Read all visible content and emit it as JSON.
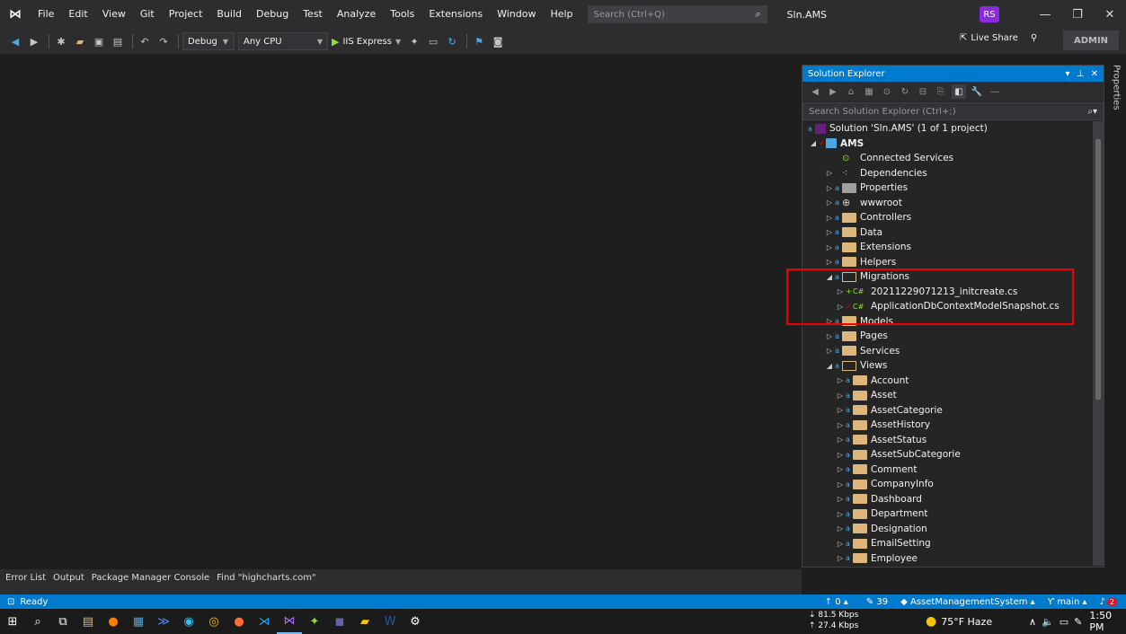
{
  "menubar": {
    "logo": "⋈",
    "items": [
      "File",
      "Edit",
      "View",
      "Git",
      "Project",
      "Build",
      "Debug",
      "Test",
      "Analyze",
      "Tools",
      "Extensions",
      "Window",
      "Help"
    ],
    "search_placeholder": "Search (Ctrl+Q)",
    "solution_name": "Sln.AMS",
    "avatar_initials": "RS"
  },
  "toolbar": {
    "config": "Debug",
    "platform": "Any CPU",
    "run_target": "IIS Express",
    "live_share": "Live Share",
    "admin": "ADMIN"
  },
  "solution_explorer": {
    "title": "Solution Explorer",
    "search_placeholder": "Search Solution Explorer (Ctrl+;)",
    "solution_label": "Solution 'Sln.AMS' (1 of 1 project)",
    "project": "AMS",
    "items": [
      {
        "label": "Connected Services",
        "indent": 3,
        "expander": "",
        "icon": "connected"
      },
      {
        "label": "Dependencies",
        "indent": 3,
        "expander": "▷",
        "icon": "deps"
      },
      {
        "label": "Properties",
        "indent": 3,
        "expander": "▷",
        "icon": "props"
      },
      {
        "label": "wwwroot",
        "indent": 3,
        "expander": "▷",
        "icon": "globe"
      },
      {
        "label": "Controllers",
        "indent": 3,
        "expander": "▷",
        "icon": "folder"
      },
      {
        "label": "Data",
        "indent": 3,
        "expander": "▷",
        "icon": "folder"
      },
      {
        "label": "Extensions",
        "indent": 3,
        "expander": "▷",
        "icon": "folder"
      },
      {
        "label": "Helpers",
        "indent": 3,
        "expander": "▷",
        "icon": "folder"
      },
      {
        "label": "Migrations",
        "indent": 3,
        "expander": "◢",
        "icon": "folder-open"
      },
      {
        "label": "20211229071213_initcreate.cs",
        "indent": 4,
        "expander": "▷",
        "icon": "cs-add"
      },
      {
        "label": "ApplicationDbContextModelSnapshot.cs",
        "indent": 4,
        "expander": "▷",
        "icon": "cs-check"
      },
      {
        "label": "Models",
        "indent": 3,
        "expander": "▷",
        "icon": "folder"
      },
      {
        "label": "Pages",
        "indent": 3,
        "expander": "▷",
        "icon": "folder"
      },
      {
        "label": "Services",
        "indent": 3,
        "expander": "▷",
        "icon": "folder"
      },
      {
        "label": "Views",
        "indent": 3,
        "expander": "◢",
        "icon": "folder-open"
      },
      {
        "label": "Account",
        "indent": 4,
        "expander": "▷",
        "icon": "folder"
      },
      {
        "label": "Asset",
        "indent": 4,
        "expander": "▷",
        "icon": "folder"
      },
      {
        "label": "AssetCategorie",
        "indent": 4,
        "expander": "▷",
        "icon": "folder"
      },
      {
        "label": "AssetHistory",
        "indent": 4,
        "expander": "▷",
        "icon": "folder"
      },
      {
        "label": "AssetStatus",
        "indent": 4,
        "expander": "▷",
        "icon": "folder"
      },
      {
        "label": "AssetSubCategorie",
        "indent": 4,
        "expander": "▷",
        "icon": "folder"
      },
      {
        "label": "Comment",
        "indent": 4,
        "expander": "▷",
        "icon": "folder"
      },
      {
        "label": "CompanyInfo",
        "indent": 4,
        "expander": "▷",
        "icon": "folder"
      },
      {
        "label": "Dashboard",
        "indent": 4,
        "expander": "▷",
        "icon": "folder"
      },
      {
        "label": "Department",
        "indent": 4,
        "expander": "▷",
        "icon": "folder"
      },
      {
        "label": "Designation",
        "indent": 4,
        "expander": "▷",
        "icon": "folder"
      },
      {
        "label": "EmailSetting",
        "indent": 4,
        "expander": "▷",
        "icon": "folder"
      },
      {
        "label": "Employee",
        "indent": 4,
        "expander": "▷",
        "icon": "folder"
      }
    ]
  },
  "properties_tab": "Properties",
  "bottom_tabs": [
    "Error List",
    "Output",
    "Package Manager Console",
    "Find \"highcharts.com\""
  ],
  "status": {
    "ready": "Ready",
    "up_count": "0",
    "edits": "39",
    "repo": "AssetManagementSystem",
    "branch": "main",
    "notifications": "2"
  },
  "taskbar": {
    "net_down": "81.5 Kbps",
    "net_up": "27.4 Kbps",
    "weather": "75°F  Haze",
    "time": "1:50 PM"
  }
}
